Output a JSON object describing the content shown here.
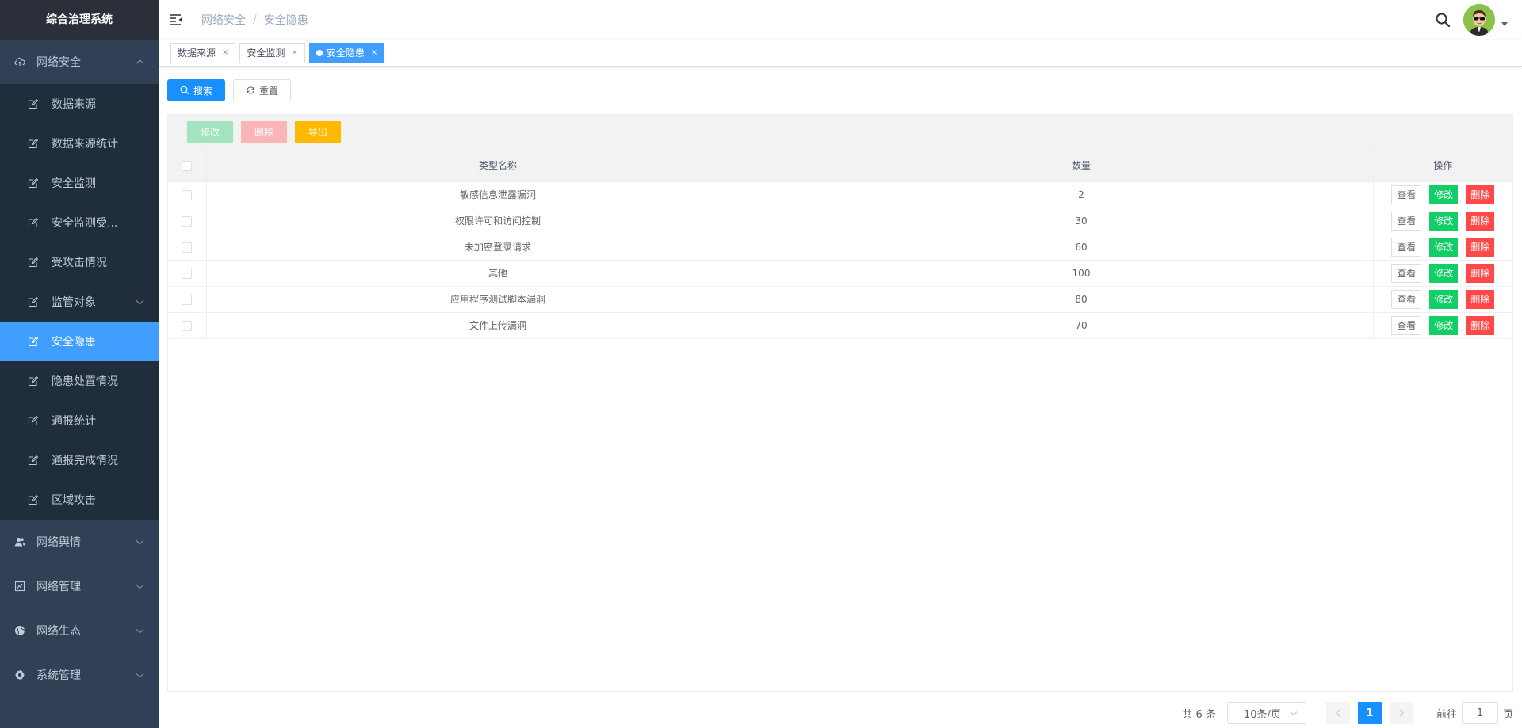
{
  "sidebar": {
    "title": "综合治理系统",
    "group_net_security": "网络安全",
    "items": [
      {
        "label": "数据来源"
      },
      {
        "label": "数据来源统计"
      },
      {
        "label": "安全监测"
      },
      {
        "label": "安全监测受..."
      },
      {
        "label": "受攻击情况"
      },
      {
        "label": "监管对象"
      },
      {
        "label": "安全隐患"
      },
      {
        "label": "隐患处置情况"
      },
      {
        "label": "通报统计"
      },
      {
        "label": "通报完成情况"
      },
      {
        "label": "区域攻击"
      }
    ],
    "groups": [
      {
        "label": "网络舆情"
      },
      {
        "label": "网络管理"
      },
      {
        "label": "网络生态"
      },
      {
        "label": "系统管理"
      }
    ]
  },
  "header": {
    "breadcrumb": [
      "网络安全",
      "安全隐患"
    ]
  },
  "tags": [
    {
      "label": "数据来源"
    },
    {
      "label": "安全监测"
    },
    {
      "label": "安全隐患"
    }
  ],
  "search_bar": {
    "search_label": "搜索",
    "reset_label": "重置"
  },
  "toolbar": {
    "edit_label": "修改",
    "delete_label": "删除",
    "export_label": "导出"
  },
  "table": {
    "headers": [
      "类型名称",
      "数量",
      "操作"
    ],
    "rows": [
      {
        "name": "敏感信息泄露漏洞",
        "count": "2"
      },
      {
        "name": "权限许可和访问控制",
        "count": "30"
      },
      {
        "name": "未加密登录请求",
        "count": "60"
      },
      {
        "name": "其他",
        "count": "100"
      },
      {
        "name": "应用程序测试脚本漏洞",
        "count": "80"
      },
      {
        "name": "文件上传漏洞",
        "count": "70"
      }
    ],
    "op_view": "查看",
    "op_edit": "修改",
    "op_delete": "删除"
  },
  "pagination": {
    "total": "共 6 条",
    "page_size": "10条/页",
    "current_page": "1",
    "goto_prefix": "前往",
    "goto_value": "1",
    "goto_suffix": "页"
  },
  "colors": {
    "sidebar_bg": "#304156",
    "submenu_bg": "#1f2d3d",
    "active": "#409eff",
    "primary": "#1890ff",
    "success": "#13ce66",
    "danger": "#ff4949",
    "warning": "#ffba00"
  }
}
